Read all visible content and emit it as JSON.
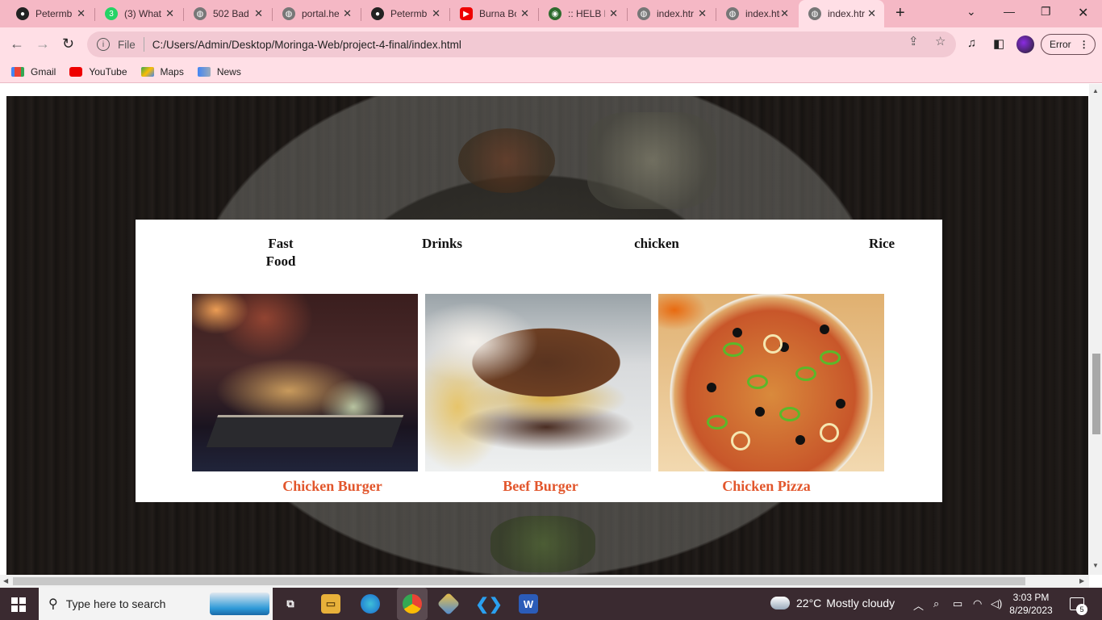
{
  "browser": {
    "tabs": [
      {
        "title": "Petermb",
        "icon": "github-icon"
      },
      {
        "title": "(3) What",
        "icon": "whatsapp-icon",
        "badge": "3"
      },
      {
        "title": "502 Bad",
        "icon": "globe-icon"
      },
      {
        "title": "portal.he",
        "icon": "globe-icon"
      },
      {
        "title": "Petermb",
        "icon": "github-icon"
      },
      {
        "title": "Burna Bo",
        "icon": "youtube-icon"
      },
      {
        "title": ":: HELB P",
        "icon": "helb-icon"
      },
      {
        "title": "index.htr",
        "icon": "globe-icon"
      },
      {
        "title": "index.htr",
        "icon": "globe-icon"
      },
      {
        "title": "index.htr",
        "icon": "globe-icon",
        "active": true
      }
    ],
    "address": {
      "scheme_label": "File",
      "url": "C:/Users/Admin/Desktop/Moringa-Web/project-4-final/index.html"
    },
    "profile_button": "Error",
    "bookmarks": [
      {
        "label": "Gmail",
        "icon": "gmail-icon"
      },
      {
        "label": "YouTube",
        "icon": "youtube-icon"
      },
      {
        "label": "Maps",
        "icon": "maps-icon"
      },
      {
        "label": "News",
        "icon": "news-icon"
      }
    ],
    "colors": {
      "tabstrip": "#f5b8c5",
      "toolbar": "#ffdfe6"
    }
  },
  "page": {
    "categories": [
      "Fast Food",
      "Drinks",
      "chicken",
      "Rice"
    ],
    "foods": [
      {
        "name": "Chicken Burger",
        "image": "chicken-burger-photo"
      },
      {
        "name": "Beef Burger",
        "image": "beef-burger-photo"
      },
      {
        "name": "Chicken Pizza",
        "image": "chicken-pizza-photo"
      }
    ],
    "colors": {
      "food_caption": "#e2562c"
    }
  },
  "taskbar": {
    "search_placeholder": "Type here to search",
    "weather": {
      "temp": "22°C",
      "condition": "Mostly cloudy"
    },
    "clock": {
      "time": "3:03 PM",
      "date": "8/29/2023"
    },
    "notification_count": "5",
    "apps": [
      "task-view-icon",
      "file-explorer-icon",
      "edge-icon",
      "chrome-icon",
      "git-icon",
      "vscode-icon",
      "word-icon"
    ]
  }
}
